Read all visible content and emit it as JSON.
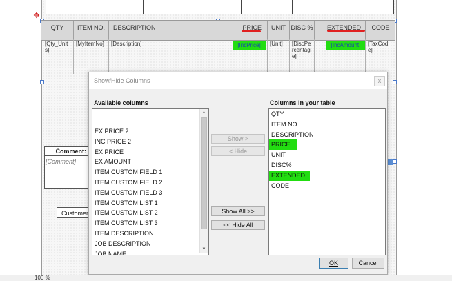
{
  "report": {
    "columns": [
      {
        "header": "QTY",
        "field": "[Qty_Units]"
      },
      {
        "header": "ITEM NO.",
        "field": "[MyItemNo]"
      },
      {
        "header": "DESCRIPTION",
        "field": "[Description]"
      },
      {
        "header": "PRICE",
        "field": "[IncPrice]"
      },
      {
        "header": "UNIT",
        "field": "[Unit]"
      },
      {
        "header": "DISC %",
        "field": "[DiscPercentage]"
      },
      {
        "header": "EXTENDED",
        "field": "[IncAmount]"
      },
      {
        "header": "CODE",
        "field": "[TaxCode]"
      }
    ],
    "comment_label": "Comment:",
    "comment_value": "[Comment]",
    "customer_label": "Customer"
  },
  "dialog": {
    "title": "Show/Hide Columns",
    "close_glyph": "x",
    "available_label": "Available columns",
    "available_columns": [
      "EX PRICE 2",
      "INC PRICE 2",
      "EX PRICE",
      "EX AMOUNT",
      "ITEM CUSTOM FIELD 1",
      "ITEM CUSTOM FIELD 2",
      "ITEM CUSTOM FIELD 3",
      "ITEM CUSTOM LIST 1",
      "ITEM CUSTOM LIST 2",
      "ITEM CUSTOM LIST 3",
      "ITEM DESCRIPTION",
      "JOB DESCRIPTION",
      "JOB NAME"
    ],
    "table_label": "Columns in your table",
    "table_columns": [
      "QTY",
      "ITEM NO.",
      "DESCRIPTION",
      "PRICE",
      "UNIT",
      "DISC%",
      "EXTENDED",
      "CODE"
    ],
    "show_button": "Show >",
    "hide_button": "< Hide",
    "show_all_button": "Show All >>",
    "hide_all_button": "<< Hide All",
    "ok_button": "OK",
    "cancel_button": "Cancel"
  },
  "status": {
    "zoom": "100 %"
  },
  "colors": {
    "highlight": "#22dd11",
    "underline": "#e02020"
  }
}
